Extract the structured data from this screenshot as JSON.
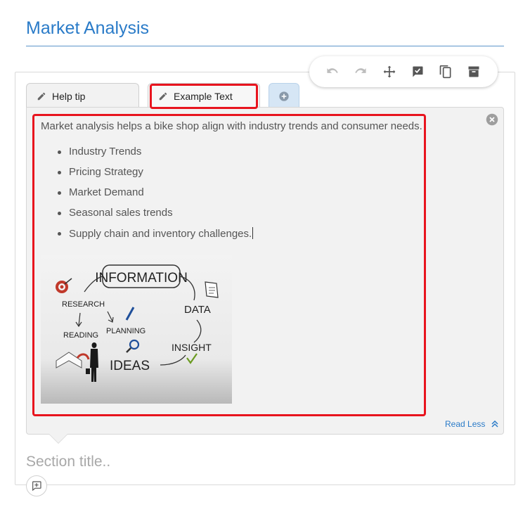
{
  "page": {
    "title": "Market Analysis"
  },
  "toolbar": {
    "items": [
      {
        "name": "undo-icon"
      },
      {
        "name": "redo-icon"
      },
      {
        "name": "move-icon"
      },
      {
        "name": "approve-icon"
      },
      {
        "name": "copy-icon"
      },
      {
        "name": "archive-icon"
      }
    ]
  },
  "tabs": [
    {
      "label": "Help tip",
      "icon": "pencil-icon"
    },
    {
      "label": "Example Text",
      "icon": "pencil-icon",
      "active": true
    },
    {
      "label": "",
      "icon": "plus-circle-icon"
    }
  ],
  "content": {
    "intro": "Market analysis helps a bike shop align with industry trends and consumer needs.",
    "bullets": [
      "Industry Trends",
      "Pricing Strategy",
      "Market Demand",
      "Seasonal sales trends",
      "Supply chain and inventory challenges."
    ],
    "illustration": {
      "words": [
        "INFORMATION",
        "RESEARCH",
        "DATA",
        "READING",
        "PLANNING",
        "INSIGHT",
        "IDEAS"
      ]
    },
    "read_less_label": "Read Less"
  },
  "section": {
    "title_placeholder": "Section title.."
  },
  "colors": {
    "accent": "#2a7bc8",
    "highlight": "#e8141e",
    "panel": "#f2f2f2"
  }
}
